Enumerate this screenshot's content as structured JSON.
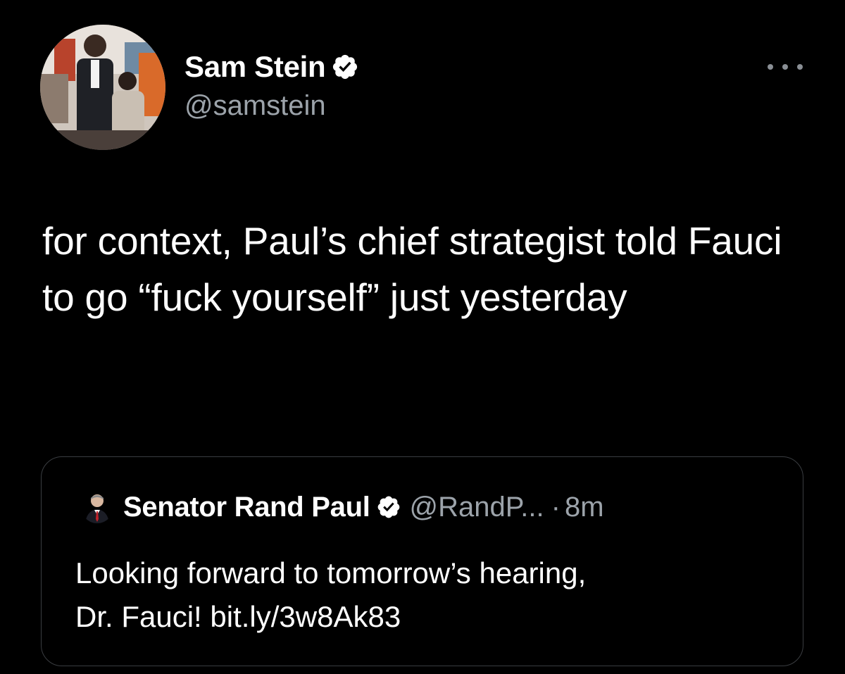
{
  "tweet": {
    "author": {
      "display_name": "Sam Stein",
      "handle": "@samstein",
      "avatar_icon": "profile-photo",
      "verified_icon": "verified-badge-icon"
    },
    "more_icon": "more-options-icon",
    "text": "for context, Paul’s chief strategist told Fauci to go “fuck yourself” just yesterday"
  },
  "quote": {
    "author": {
      "display_name": "Senator Rand Paul",
      "handle": "@RandP...",
      "avatar_icon": "profile-photo",
      "verified_icon": "verified-badge-icon"
    },
    "separator": "·",
    "time": "8m",
    "text_line1": "Looking forward to tomorrow’s hearing,",
    "text_line2": "Dr. Fauci! bit.ly/3w8Ak83"
  },
  "colors": {
    "background": "#000000",
    "primary_text": "#ffffff",
    "secondary_text": "#9ca3aa",
    "border": "#3a3d41"
  }
}
